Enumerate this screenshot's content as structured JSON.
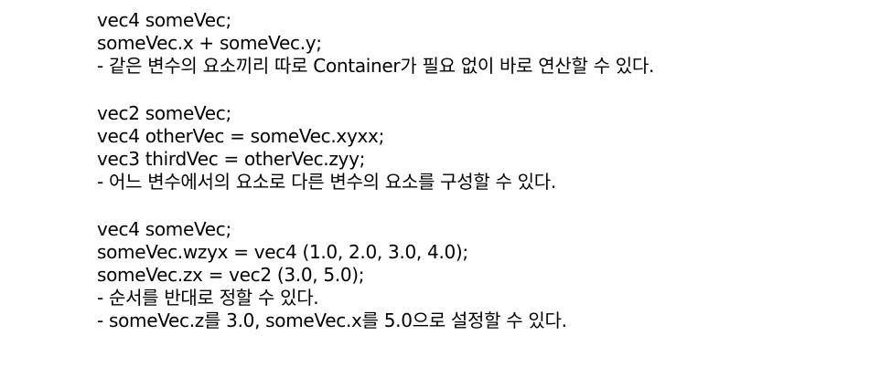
{
  "blocks": [
    {
      "lines": [
        "vec4 someVec;",
        "someVec.x + someVec.y;",
        "- 같은 변수의 요소끼리 따로 Container가 필요 없이 바로 연산할 수 있다."
      ]
    },
    {
      "lines": [
        "vec2 someVec;",
        "vec4 otherVec = someVec.xyxx;",
        "vec3 thirdVec = otherVec.zyy;",
        "- 어느 변수에서의 요소로 다른 변수의 요소를 구성할 수 있다."
      ]
    },
    {
      "lines": [
        "vec4 someVec;",
        "someVec.wzyx = vec4 (1.0, 2.0, 3.0, 4.0);",
        "someVec.zx = vec2 (3.0, 5.0);",
        "- 순서를 반대로 정할 수 있다.",
        "- someVec.z를 3.0, someVec.x를 5.0으로 설정할 수 있다."
      ]
    }
  ]
}
